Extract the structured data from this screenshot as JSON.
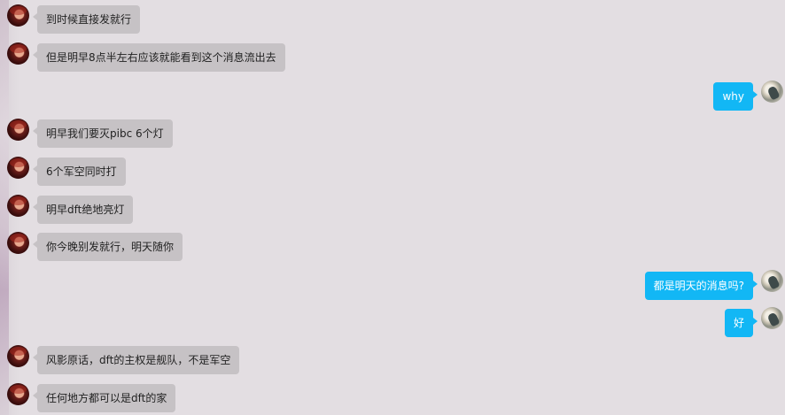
{
  "colors": {
    "peer_bubble": "#c6c2c5",
    "self_bubble": "#12b7f5",
    "background": "#e2dde1"
  },
  "messages": [
    {
      "side": "left",
      "text": "到时候直接发就行"
    },
    {
      "side": "left",
      "text": "但是明早8点半左右应该就能看到这个消息流出去"
    },
    {
      "side": "right",
      "text": "why"
    },
    {
      "side": "left",
      "text": "明早我们要灭pibc 6个灯"
    },
    {
      "side": "left",
      "text": "6个军空同时打"
    },
    {
      "side": "left",
      "text": "明早dft绝地亮灯"
    },
    {
      "side": "left",
      "text": "你今晚别发就行，明天随你"
    },
    {
      "side": "right",
      "text": "都是明天的消息吗?"
    },
    {
      "side": "right",
      "text": "好"
    },
    {
      "side": "left",
      "text": "风影原话，dft的主权是舰队，不是军空"
    },
    {
      "side": "left",
      "text": "任何地方都可以是dft的家"
    }
  ]
}
